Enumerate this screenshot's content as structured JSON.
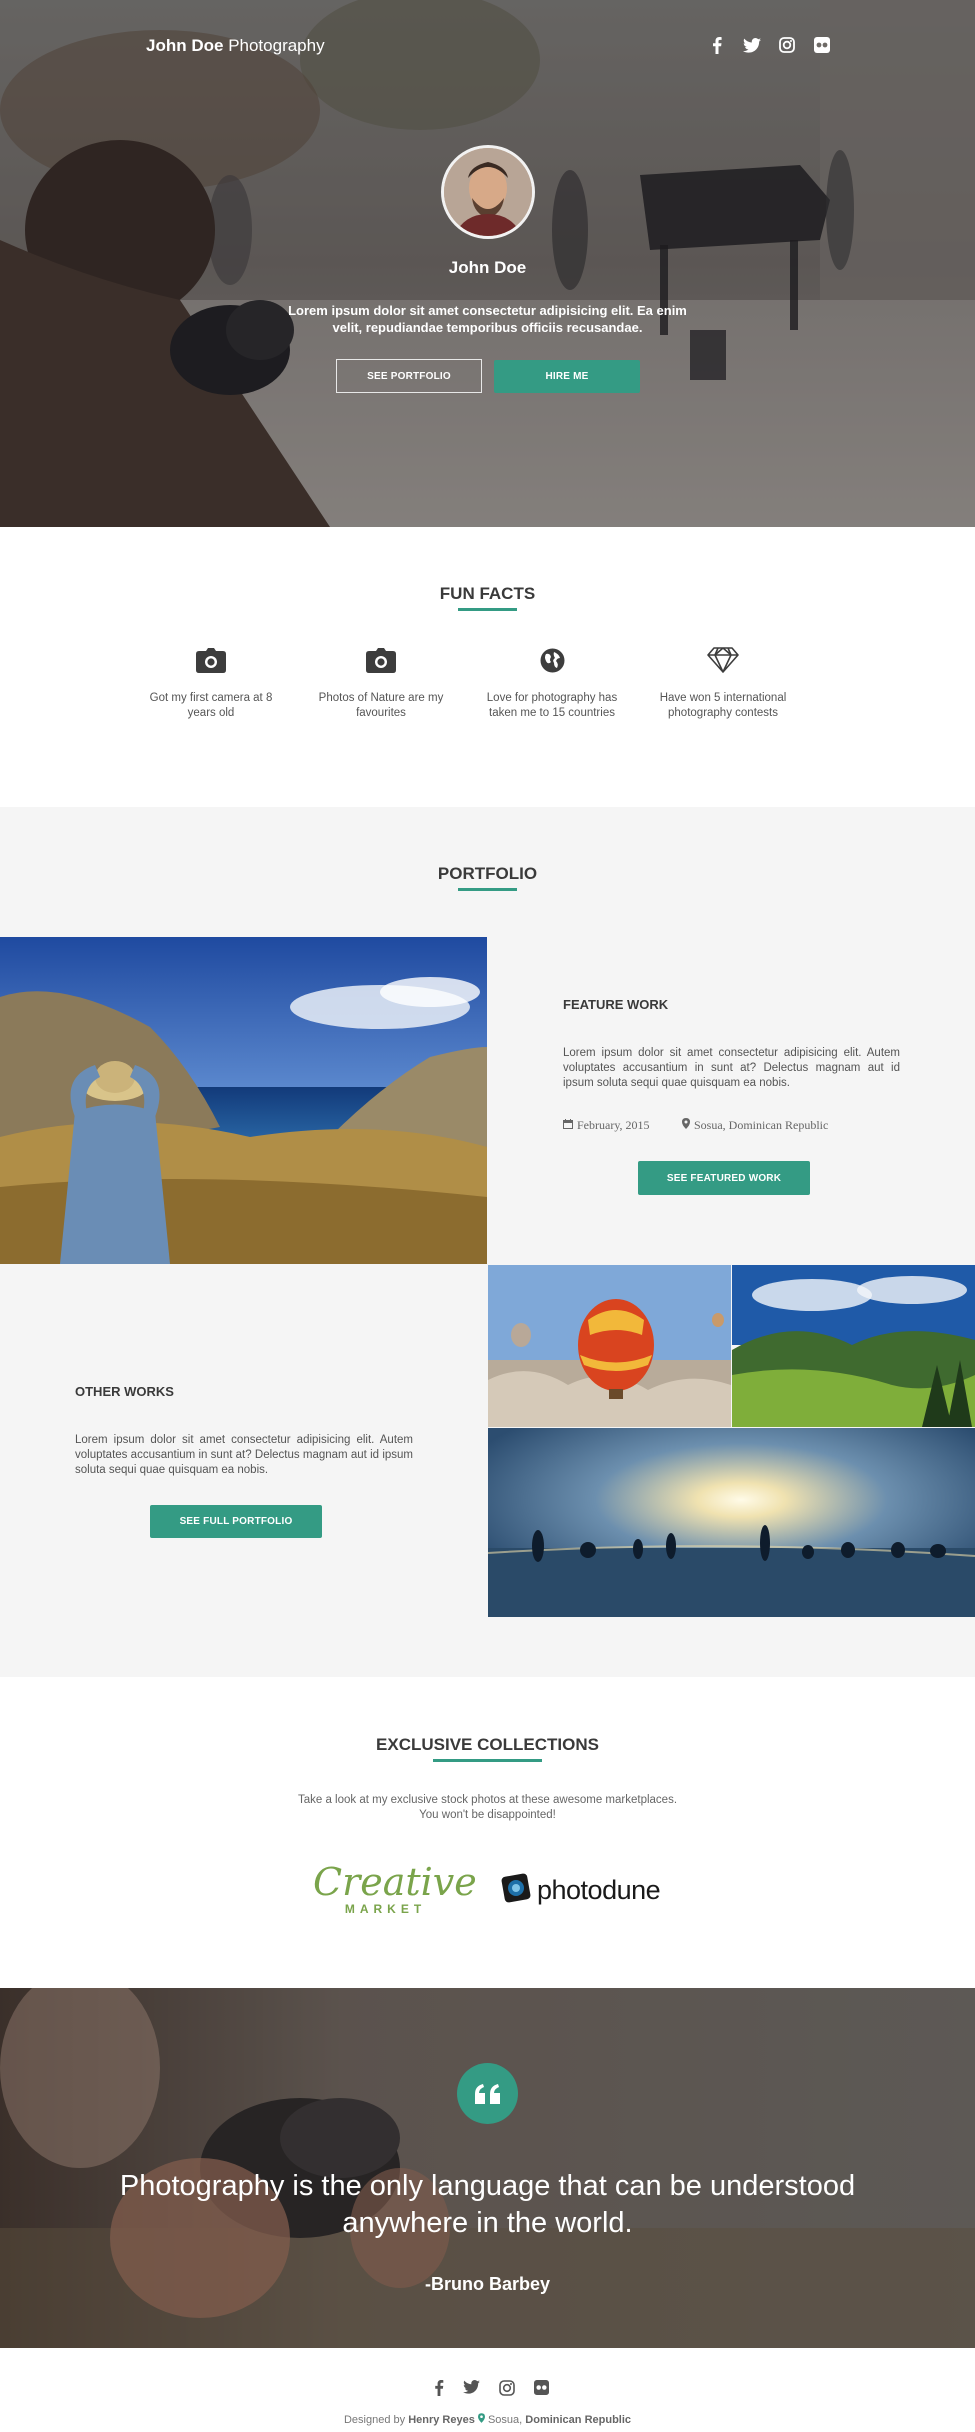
{
  "colors": {
    "accent": "#349b84",
    "text_dark": "#3a3a3a",
    "section_bg": "#f5f5f5"
  },
  "header": {
    "brand_first": "John Doe",
    "brand_second": "Photography",
    "social": [
      "facebook-icon",
      "twitter-icon",
      "instagram-icon",
      "flickr-icon"
    ]
  },
  "hero": {
    "name": "John Doe",
    "text": "Lorem ipsum dolor sit amet consectetur adipisicing elit. Ea enim velit, repudiandae temporibus officiis recusandae.",
    "btn_portfolio": "SEE PORTFOLIO",
    "btn_hire": "HIRE ME"
  },
  "fun_facts": {
    "title": "FUN FACTS",
    "items": [
      {
        "icon": "camera-icon",
        "text": "Got my first camera at 8 years old"
      },
      {
        "icon": "camera-icon",
        "text": "Photos of Nature are my favourites"
      },
      {
        "icon": "globe-icon",
        "text": "Love for photography has taken me to 15 countries"
      },
      {
        "icon": "diamond-icon",
        "text": "Have won 5 international photography contests"
      }
    ]
  },
  "portfolio": {
    "title": "PORTFOLIO",
    "feature": {
      "title": "FEATURE WORK",
      "text": "Lorem ipsum dolor sit amet consectetur adipisicing elit. Autem voluptates accusantium in sunt at? Delectus magnam aut id ipsum soluta sequi quae quisquam ea nobis.",
      "date": "February, 2015",
      "location": "Sosua, Dominican Republic",
      "button": "SEE FEATURED WORK"
    },
    "other": {
      "title": "OTHER WORKS",
      "text": "Lorem ipsum dolor sit amet consectetur adipisicing elit. Autem voluptates accusantium in sunt at? Delectus magnam aut id ipsum soluta sequi quae quisquam ea nobis.",
      "button": "SEE FULL PORTFOLIO"
    }
  },
  "collections": {
    "title": "EXCLUSIVE COLLECTIONS",
    "text": "Take a look at my exclusive stock photos at these awesome marketplaces. You won't be disappointed!",
    "creative_market_line1": "Creative",
    "creative_market_line2": "MARKET",
    "photodune": "photodune"
  },
  "quote": {
    "text": "Photography is the only language that can be understood anywhere in the world.",
    "author": "-Bruno Barbey"
  },
  "footer": {
    "designed_by": "Designed by",
    "designer": "Henry Reyes",
    "city": "Sosua,",
    "country": "Dominican Republic"
  }
}
